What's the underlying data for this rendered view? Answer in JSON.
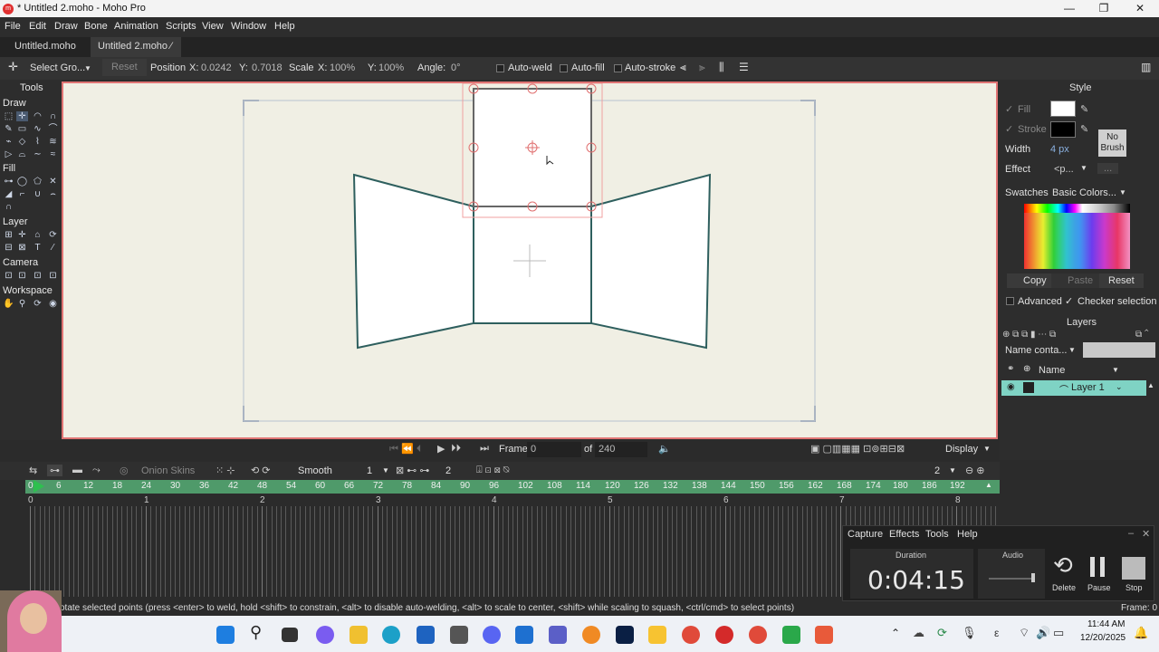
{
  "window": {
    "title": "* Untitled 2.moho - Moho Pro",
    "app_icon": "moho-icon"
  },
  "menu": [
    "File",
    "Edit",
    "Draw",
    "Bone",
    "Animation",
    "Scripts",
    "View",
    "Window",
    "Help"
  ],
  "tabs": [
    {
      "label": "Untitled.moho"
    },
    {
      "label": "Untitled 2.moho",
      "modified_mark": "⁄"
    }
  ],
  "toolopts": {
    "select_group": "Select Gro...",
    "reset": "Reset",
    "position": "Position",
    "x_label": "X:",
    "x_val": "0.0242",
    "y_label": "Y:",
    "y_val": "0.7018",
    "scale": "Scale",
    "sx_label": "X:",
    "sx_val": "100%",
    "sy_label": "Y:",
    "sy_val": "100%",
    "angle": "Angle:",
    "angle_val": "0°",
    "autoweld": "Auto-weld",
    "autofill": "Auto-fill",
    "autostroke": "Auto-stroke"
  },
  "tools": {
    "title": "Tools",
    "draw": "Draw",
    "fill": "Fill",
    "layer": "Layer",
    "camera": "Camera",
    "workspace": "Workspace"
  },
  "style": {
    "title": "Style",
    "fill": "Fill",
    "stroke": "Stroke",
    "width": "Width",
    "width_val": "4 px",
    "no_brush": "No\nBrush",
    "effect": "Effect",
    "effect_val": "<p...",
    "effect_more": "...",
    "swatches": "Swatches",
    "swatch_set": "Basic Colors...",
    "copy": "Copy",
    "paste": "Paste",
    "reset": "Reset",
    "advanced": "Advanced",
    "checker": "Checker selection",
    "fill_color": "#ffffff",
    "stroke_color": "#000000"
  },
  "layers": {
    "title": "Layers",
    "filter": "Name conta...",
    "name_col": "Name",
    "layer1": "Layer 1",
    "accent": "#7fd3c4"
  },
  "playbar": {
    "frame_label": "Frame",
    "frame_val": "0",
    "of": "of",
    "total": "240",
    "display": "Display"
  },
  "timeline": {
    "onion": "Onion Skins",
    "interp": "Smooth",
    "interp_num": "1",
    "step": "2",
    "zoom": "2",
    "frames": [
      "0",
      "6",
      "12",
      "18",
      "24",
      "30",
      "36",
      "42",
      "48",
      "54",
      "60",
      "66",
      "72",
      "78",
      "84",
      "90",
      "96",
      "102",
      "108",
      "114",
      "120",
      "126",
      "132",
      "138",
      "144",
      "150",
      "156",
      "162",
      "168",
      "174",
      "180",
      "186",
      "192"
    ],
    "seconds": [
      "0",
      "1",
      "2",
      "3",
      "4",
      "5",
      "6",
      "7",
      "8"
    ]
  },
  "status": {
    "text": "otate selected points (press <enter> to weld, hold <shift> to constrain, <alt> to disable auto-welding, <alt> to scale to center, <shift> while scaling to squash, <ctrl/cmd> to select points)",
    "frame": "Frame: 0"
  },
  "recorder": {
    "tabs": [
      "Capture",
      "Effects",
      "Tools",
      "Help"
    ],
    "duration_label": "Duration",
    "duration": "0:04:15",
    "audio_label": "Audio",
    "delete": "Delete",
    "pause": "Pause",
    "stop": "Stop"
  },
  "clock": {
    "time": "11:44 AM",
    "date": "12/20/2025"
  }
}
